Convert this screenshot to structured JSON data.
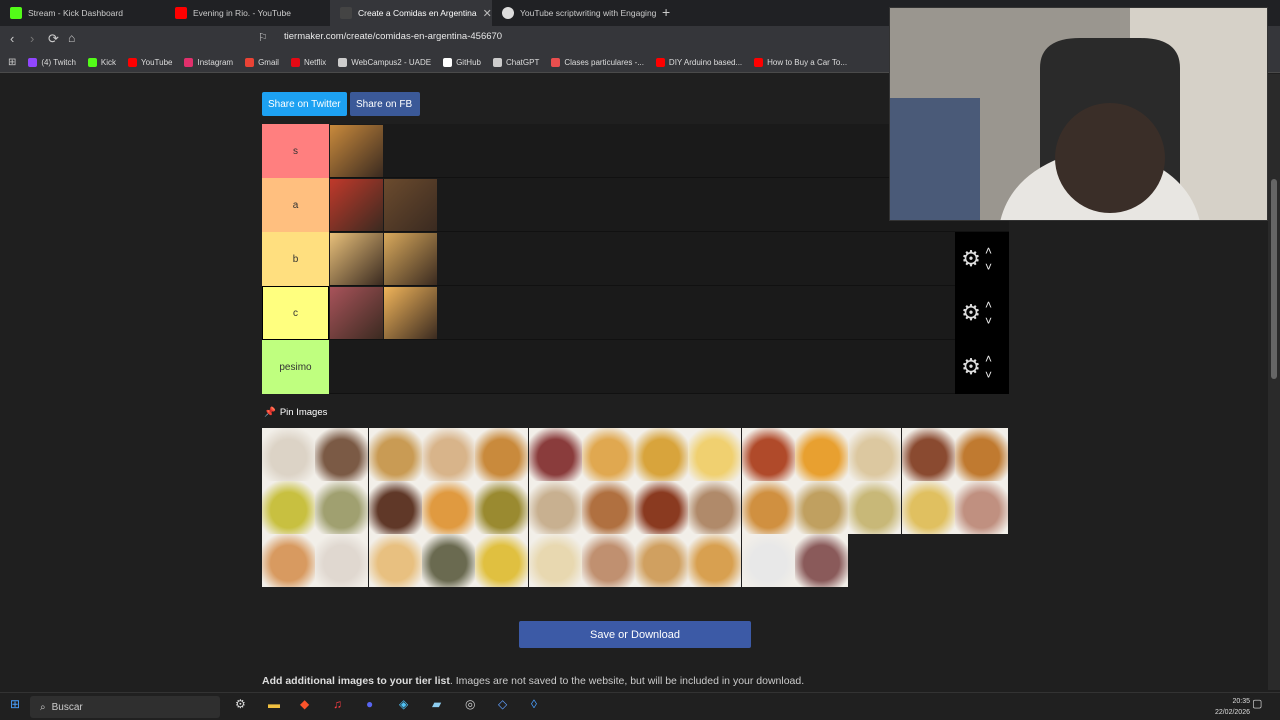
{
  "browser": {
    "tabs": [
      {
        "title": "Stream - Kick Dashboard",
        "color": "#53fc18"
      },
      {
        "title": "Evening in Rio. - YouTube",
        "color": "#ff0000"
      },
      {
        "title": "Create a Comidas en Argentina",
        "color": "#2b2b2b"
      },
      {
        "title": "YouTube scriptwriting with Engaging",
        "color": "#ffffff"
      }
    ],
    "url": "tiermaker.com/create/comidas-en-argentina-456670",
    "bookmarks": [
      {
        "label": "(4) Twitch",
        "color": "#9146ff"
      },
      {
        "label": "Kick",
        "color": "#53fc18"
      },
      {
        "label": "YouTube",
        "color": "#ff0000"
      },
      {
        "label": "Instagram",
        "color": "#e1306c"
      },
      {
        "label": "Gmail",
        "color": "#ea4335"
      },
      {
        "label": "Netflix",
        "color": "#e50914"
      },
      {
        "label": "WebCampus2 - UADE",
        "color": "#cccccc"
      },
      {
        "label": "GitHub",
        "color": "#ffffff"
      },
      {
        "label": "ChatGPT",
        "color": "#cccccc"
      },
      {
        "label": "Clases particulares -...",
        "color": "#e94e4e"
      },
      {
        "label": "DIY Arduino based...",
        "color": "#ff0000"
      },
      {
        "label": "How to Buy a Car To...",
        "color": "#ff0000"
      }
    ]
  },
  "share": {
    "twitter": "Share on Twitter",
    "facebook": "Share on FB"
  },
  "tiers": [
    {
      "label": "s",
      "color": "#ff7f7f",
      "items": [
        "#c98a3c"
      ]
    },
    {
      "label": "a",
      "color": "#ffbf7f",
      "items": [
        "#c0392b",
        "#6b4b2e"
      ]
    },
    {
      "label": "b",
      "color": "#ffdf7f",
      "items": [
        "#e8c07a",
        "#d8a95c"
      ]
    },
    {
      "label": "c",
      "color": "#ffff7f",
      "items": [
        "#a8535a",
        "#f0b45a"
      ]
    },
    {
      "label": "pesimo",
      "color": "#bfff7f",
      "items": []
    }
  ],
  "pin_images": {
    "label": "Pin Images",
    "items": [
      "#dcd3c6",
      "#7b5a45",
      "#c99b54",
      "#d8b48a",
      "#c98a3c",
      "#8a3c3c",
      "#e0a850",
      "#d8a43c",
      "#f0d070",
      "#b04a2a",
      "#e8a030",
      "#dcc8a0",
      "#8a4a30",
      "#c07a30",
      "#c8c040",
      "#a0a070",
      "#603828",
      "#e09a40",
      "#9a8a30",
      "#c8b090",
      "#b07040",
      "#8a3a20",
      "#b08a6a",
      "#d09040",
      "#c0a060",
      "#c8b878",
      "#e0c060",
      "#c09080",
      "#d89a60",
      "#e0d8d0",
      "#e8c080",
      "#6a6a50",
      "#e0c040",
      "#e8d8b0",
      "#c09070",
      "#d0a060",
      "#d8a050",
      "#e8e8e8",
      "#8a5a5a"
    ]
  },
  "buttons": {
    "save": "Save or Download"
  },
  "add_note": {
    "bold": "Add additional images to your tier list",
    "rest": ". Images are not saved to the website, but will be included in your download."
  },
  "taskbar": {
    "search": "Buscar",
    "time": "20:35",
    "date": "22/02/2026"
  }
}
